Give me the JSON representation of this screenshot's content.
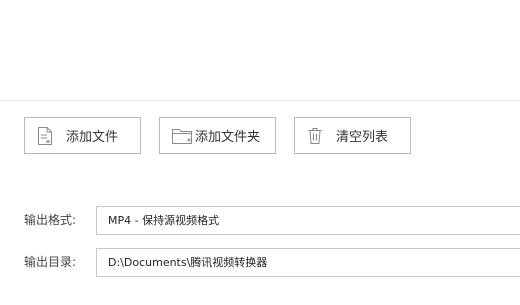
{
  "toolbar": {
    "add_file": {
      "label": "添加文件",
      "icon": "add-file-icon"
    },
    "add_folder": {
      "label": "添加文件夹",
      "icon": "add-folder-icon"
    },
    "clear_list": {
      "label": "清空列表",
      "icon": "trash-icon"
    }
  },
  "settings": {
    "output_format": {
      "label": "输出格式:",
      "value": "MP4 - 保持源视频格式"
    },
    "output_dir": {
      "label": "输出目录:",
      "value": "D:\\Documents\\腾讯视频转换器"
    }
  },
  "colors": {
    "border": "#b9b9b9",
    "divider": "#e6e6e6",
    "text": "#333333",
    "icon": "#8a8a8a"
  }
}
